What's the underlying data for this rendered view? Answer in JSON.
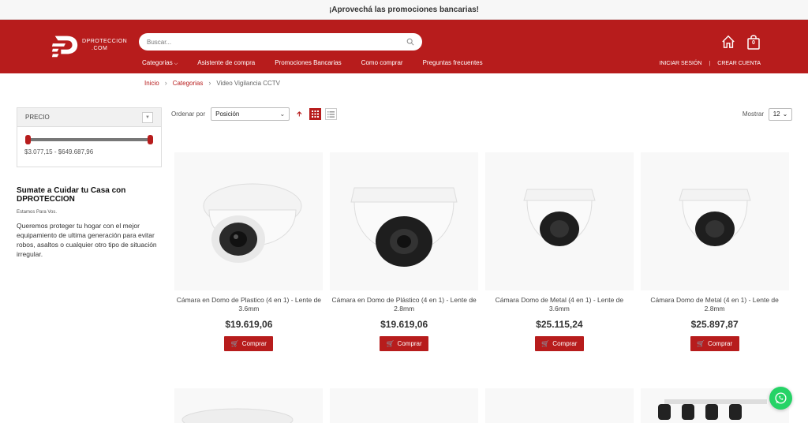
{
  "promo_bar": {
    "text": "¡Aprovechá las promociones bancarias!"
  },
  "header": {
    "logo_text_line1": "DPROTECCION",
    "logo_text_line2": ".COM",
    "search_placeholder": "Buscar...",
    "nav": [
      "Categorias",
      "Asistente de compra",
      "Promociones Bancarias",
      "Como comprar",
      "Preguntas frecuentes"
    ],
    "cart_count": "0",
    "login_label": "INICIAR SESIÓN",
    "signup_label": "CREAR CUENTA",
    "accent_color": "#b71c1c"
  },
  "breadcrumb": {
    "home": "Inicio",
    "category": "Categorias",
    "current": "Video Vigilancia CCTV"
  },
  "sidebar": {
    "price_title": "PRECIO",
    "price_range": "$3.077,15 - $649.687,96",
    "promo_title": "Sumate a Cuidar tu Casa con DPROTECCION",
    "promo_subtitle": "Estamos Para Vos.",
    "promo_text": "Queremos proteger tu hogar con el mejor equipamiento de ultima generación para evitar robos, asaltos o cualquier otro tipo de situación irregular."
  },
  "toolbar": {
    "sort_label": "Ordenar por",
    "sort_value": "Posición",
    "show_label": "Mostrar",
    "show_value": "12"
  },
  "products": [
    {
      "name": "Cámara en Domo de Plastico (4 en 1) - Lente de 3.6mm",
      "price": "$19.619,06",
      "button": "Comprar"
    },
    {
      "name": "Cámara en Domo de Plástico (4 en 1) - Lente de 2.8mm",
      "price": "$19.619,06",
      "button": "Comprar"
    },
    {
      "name": "Cámara Domo de Metal (4 en 1) - Lente de 3.6mm",
      "price": "$25.115,24",
      "button": "Comprar"
    },
    {
      "name": "Cámara Domo de Metal (4 en 1) - Lente de 2.8mm",
      "price": "$25.897,87",
      "button": "Comprar"
    }
  ]
}
